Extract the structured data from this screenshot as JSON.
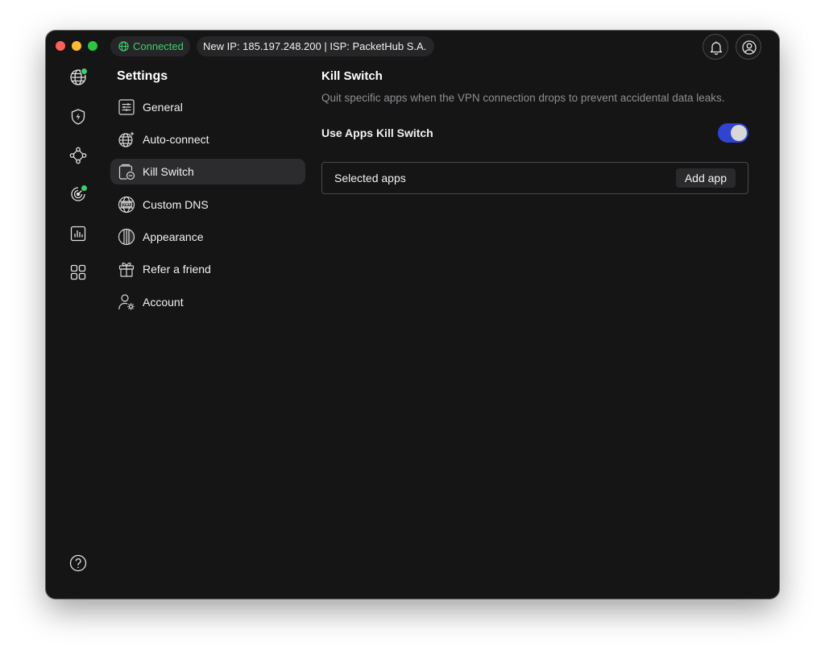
{
  "titlebar": {
    "status_label": "Connected",
    "ip_info": "New IP: 185.197.248.200 | ISP: PacketHub S.A."
  },
  "settings": {
    "title": "Settings",
    "items": [
      {
        "label": "General",
        "icon": "sliders-icon"
      },
      {
        "label": "Auto-connect",
        "icon": "globe-sparkle-icon"
      },
      {
        "label": "Kill Switch",
        "icon": "kill-switch-icon",
        "active": true
      },
      {
        "label": "Custom DNS",
        "icon": "dns-globe-icon"
      },
      {
        "label": "Appearance",
        "icon": "appearance-icon"
      },
      {
        "label": "Refer a friend",
        "icon": "gift-icon"
      },
      {
        "label": "Account",
        "icon": "account-gear-icon"
      }
    ]
  },
  "content": {
    "title": "Kill Switch",
    "description": "Quit specific apps when the VPN connection drops to prevent accidental data leaks.",
    "toggle_label": "Use Apps Kill Switch",
    "toggle_on": true,
    "selected_apps_label": "Selected apps",
    "add_app_label": "Add app"
  },
  "colors": {
    "connected": "#3ecf6a",
    "toggle_on": "#2f45d2",
    "window_bg": "#151516"
  }
}
